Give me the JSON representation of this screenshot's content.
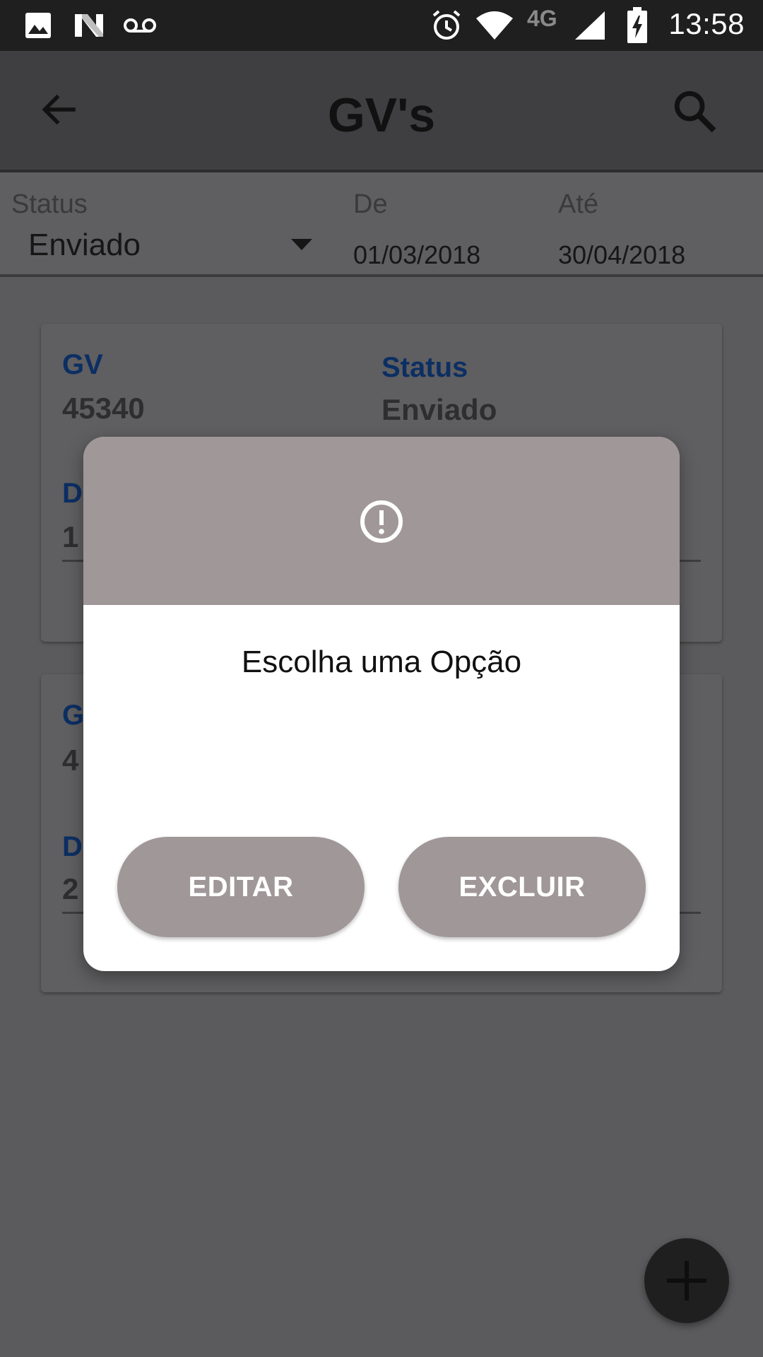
{
  "status_bar": {
    "time": "13:58",
    "network_label": "4G",
    "icons": [
      "image-icon",
      "n-icon",
      "voicemail-icon",
      "alarm-icon",
      "wifi-icon",
      "signal-icon",
      "battery-charging-icon"
    ]
  },
  "app_bar": {
    "title": "GV's",
    "back_icon": "arrow-back-icon",
    "search_icon": "search-icon"
  },
  "filters": {
    "status_label": "Status",
    "status_value": "Enviado",
    "from_label": "De",
    "from_value": "01/03/2018",
    "to_label": "Até",
    "to_value": "30/04/2018"
  },
  "cards": [
    {
      "gv_label": "GV",
      "gv_value": "45340",
      "status_label": "Status",
      "status_value": "Enviado",
      "field_label_partial": "D",
      "field_value_partial": "1"
    },
    {
      "gv_label_partial": "G",
      "gv_value_partial": "4",
      "field_label_partial": "D",
      "field_value_partial": "2"
    }
  ],
  "dialog": {
    "icon": "alert-circle-icon",
    "message": "Escolha uma Opção",
    "edit_button": "EDITAR",
    "delete_button": "EXCLUIR"
  },
  "fab": {
    "icon": "plus-icon"
  },
  "colors": {
    "dialog_header": "#a09799",
    "button_bg": "#a09799",
    "label_blue": "#0c2f63",
    "status_bar": "#1f1f1f",
    "scrim_bg": "#5b5a5c"
  }
}
